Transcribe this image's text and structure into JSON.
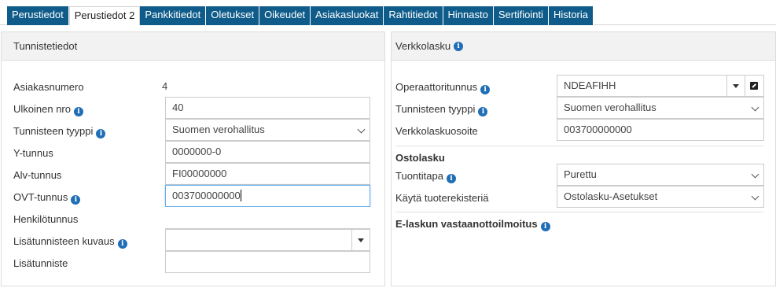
{
  "tabs": [
    {
      "label": "Perustiedot",
      "active": false
    },
    {
      "label": "Perustiedot 2",
      "active": true
    },
    {
      "label": "Pankkitiedot",
      "active": false
    },
    {
      "label": "Oletukset",
      "active": false
    },
    {
      "label": "Oikeudet",
      "active": false
    },
    {
      "label": "Asiakasluokat",
      "active": false
    },
    {
      "label": "Rahtitiedot",
      "active": false
    },
    {
      "label": "Hinnasto",
      "active": false
    },
    {
      "label": "Sertifiointi",
      "active": false
    },
    {
      "label": "Historia",
      "active": false
    }
  ],
  "left_panel": {
    "title": "Tunnistetiedot",
    "asiakasnumero_label": "Asiakasnumero",
    "asiakasnumero_value": "4",
    "ulkoinen_label": "Ulkoinen nro",
    "ulkoinen_value": "40",
    "tunnisteen_tyyppi_label": "Tunnisteen tyyppi",
    "tunnisteen_tyyppi_value": "Suomen verohallitus",
    "ytunnus_label": "Y-tunnus",
    "ytunnus_value": "0000000-0",
    "alv_label": "Alv-tunnus",
    "alv_value": "FI00000000",
    "ovt_label": "OVT-tunnus",
    "ovt_value": "003700000000",
    "henkilotunnus_label": "Henkilötunnus",
    "henkilotunnus_value": "",
    "lisatunnisteen_kuvaus_label": "Lisätunnisteen kuvaus",
    "lisatunnisteen_kuvaus_value": "",
    "lisatunniste_label": "Lisätunniste",
    "lisatunniste_value": ""
  },
  "right_panel": {
    "title": "Verkkolasku",
    "operaattori_label": "Operaattoritunnus",
    "operaattori_value": "NDEAFIHH",
    "tunnisteen_tyyppi_label": "Tunnisteen tyyppi",
    "tunnisteen_tyyppi_value": "Suomen verohallitus",
    "verkkolaskuosoite_label": "Verkkolaskuosoite",
    "verkkolaskuosoite_value": "003700000000",
    "ostolasku_title": "Ostolasku",
    "tuontitapa_label": "Tuontitapa",
    "tuontitapa_value": "Purettu",
    "tuoterekisteri_label": "Käytä tuoterekisteriä",
    "tuoterekisteri_value": "Ostolasku-Asetukset",
    "e_laskun_title": "E-laskun vastaanottoilmoitus"
  },
  "icons": {
    "info": "info-circle-icon",
    "dropdown": "chevron-down-icon",
    "combo": "triangle-down-icon",
    "external": "external-link-icon"
  },
  "colors": {
    "tab_bg": "#0f5c8a",
    "info_icon": "#1f6eb6",
    "focus_border": "#66afe9"
  }
}
